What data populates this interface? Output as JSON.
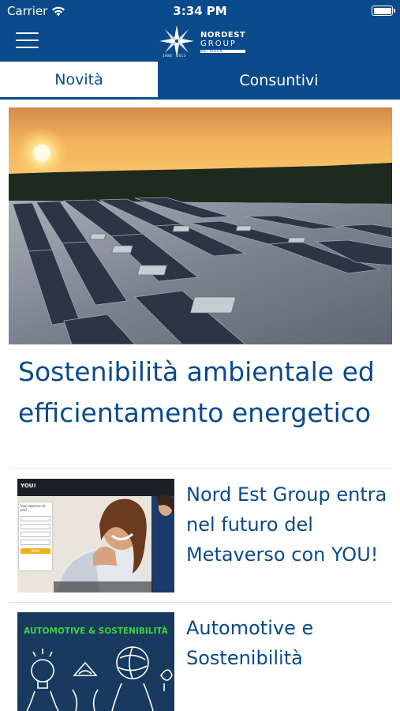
{
  "status_bar": {
    "carrier": "Carrier",
    "time": "3:34 PM",
    "battery_level": 1.0
  },
  "header": {
    "logo": {
      "line1": "NORDEST",
      "line2": "GROUP",
      "line3": "NETWORK",
      "year": "1988 · 2013"
    }
  },
  "tabs": [
    {
      "label": "Novità",
      "active": true
    },
    {
      "label": "Consuntivi",
      "active": false
    }
  ],
  "hero": {
    "title": "Sostenibilità ambientale ed efficientamento energetico"
  },
  "articles": [
    {
      "title": "Nord Est Group entra nel futuro del Metaverso con YOU!",
      "thumb": {
        "brand": "YOU!",
        "form_title": "Vuoi saperne di più?",
        "submit": "INVIA"
      }
    },
    {
      "title": "Automotive e Sostenibilità",
      "thumb": {
        "banner": "AUTOMOTIVE & SOSTENIBILITÀ"
      }
    }
  ],
  "colors": {
    "brand_blue": "#0a4a8a",
    "banner_green": "#3fd13f"
  },
  "icons": [
    "hamburger-menu-icon",
    "wifi-icon",
    "battery-icon",
    "compass-star-logo-icon"
  ]
}
